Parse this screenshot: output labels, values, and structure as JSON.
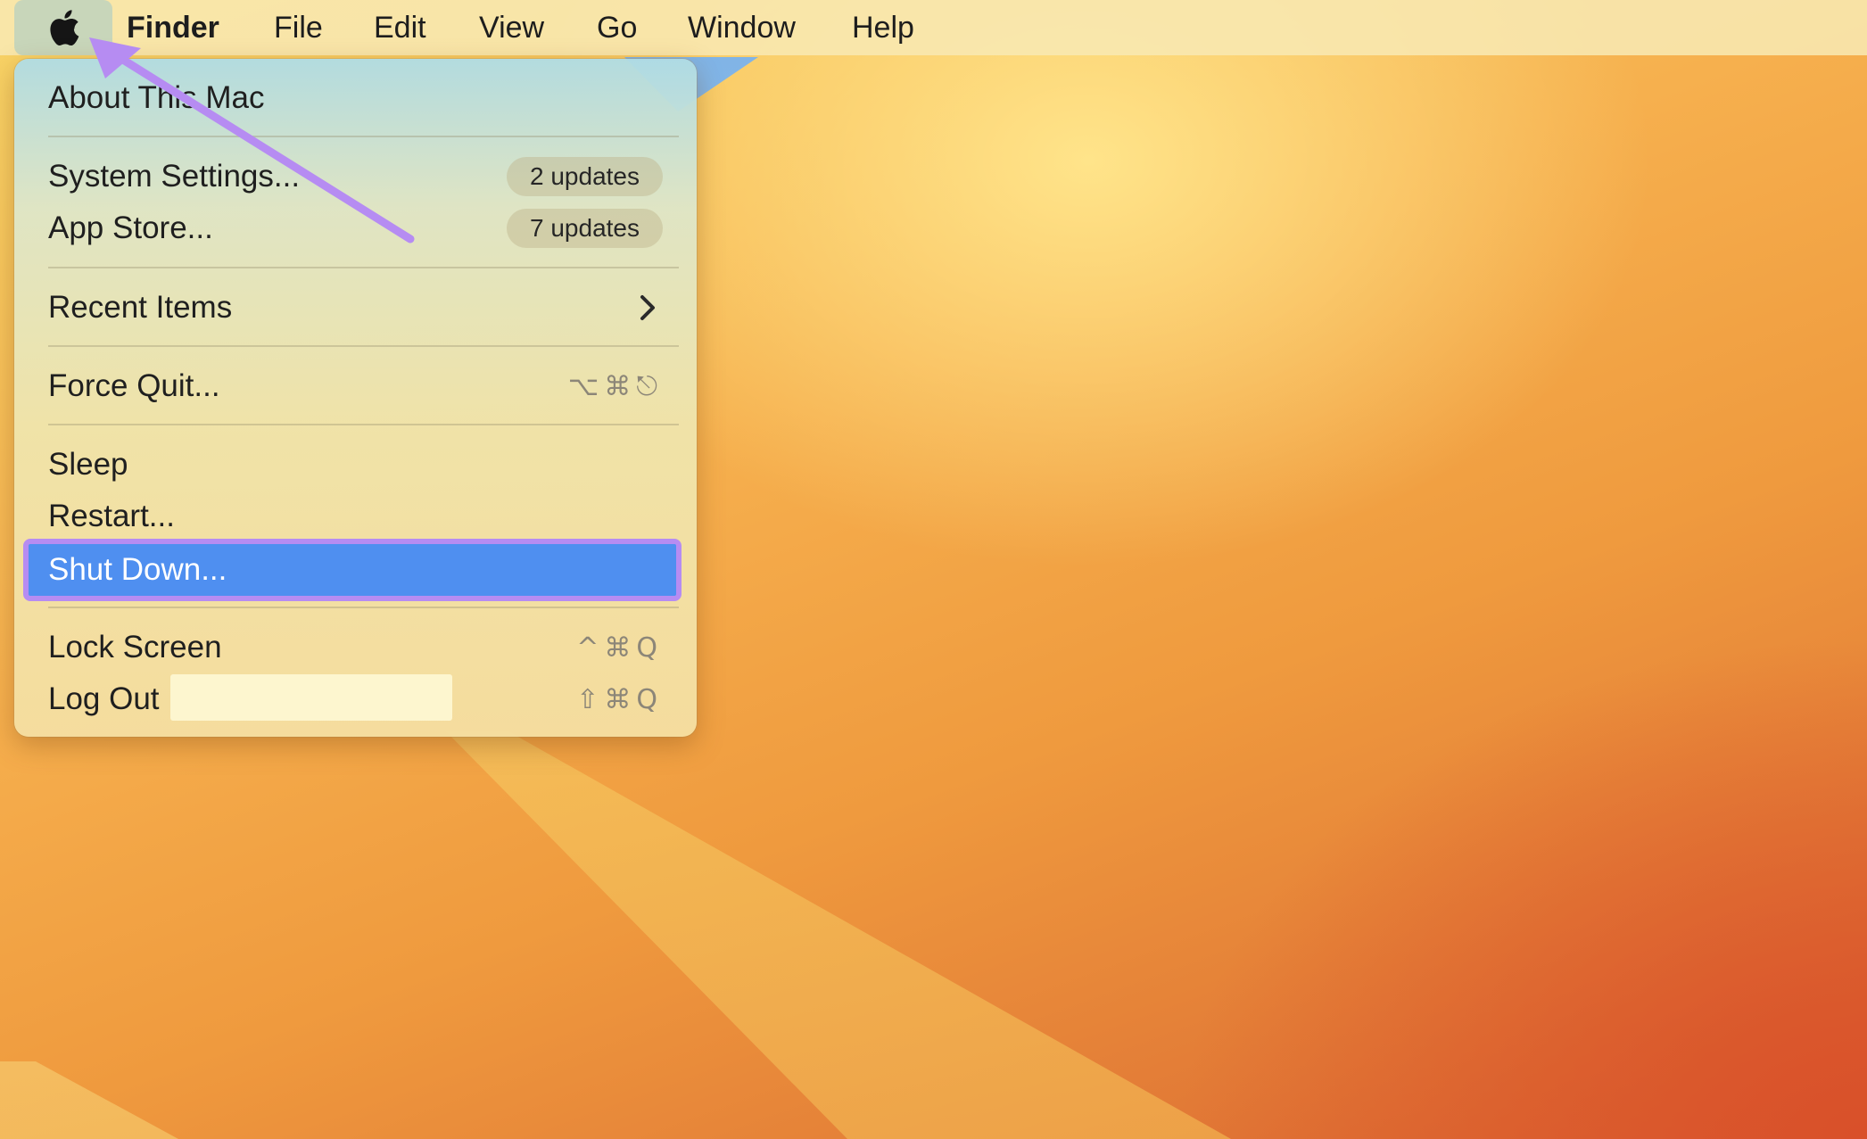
{
  "menubar": {
    "apple_icon": "apple-logo-icon",
    "app_name": "Finder",
    "menus": [
      "File",
      "Edit",
      "View",
      "Go",
      "Window",
      "Help"
    ]
  },
  "apple_menu": {
    "about": "About This Mac",
    "system_settings": {
      "label": "System Settings...",
      "badge": "2 updates"
    },
    "app_store": {
      "label": "App Store...",
      "badge": "7 updates"
    },
    "recent_items": {
      "label": "Recent Items",
      "icon": "chevron-right-icon"
    },
    "force_quit": {
      "label": "Force Quit...",
      "shortcut": "⌥⌘⎋"
    },
    "sleep": "Sleep",
    "restart": "Restart...",
    "shut_down": "Shut Down...",
    "lock_screen": {
      "label": "Lock Screen",
      "shortcut": "^⌘Q"
    },
    "log_out": {
      "label": "Log Out",
      "shortcut": "⇧⌘Q"
    }
  },
  "annotations": {
    "arrow_color": "#b68cf2",
    "highlight_border_color": "#b68cf2",
    "selected_color": "#4f8ff0"
  }
}
